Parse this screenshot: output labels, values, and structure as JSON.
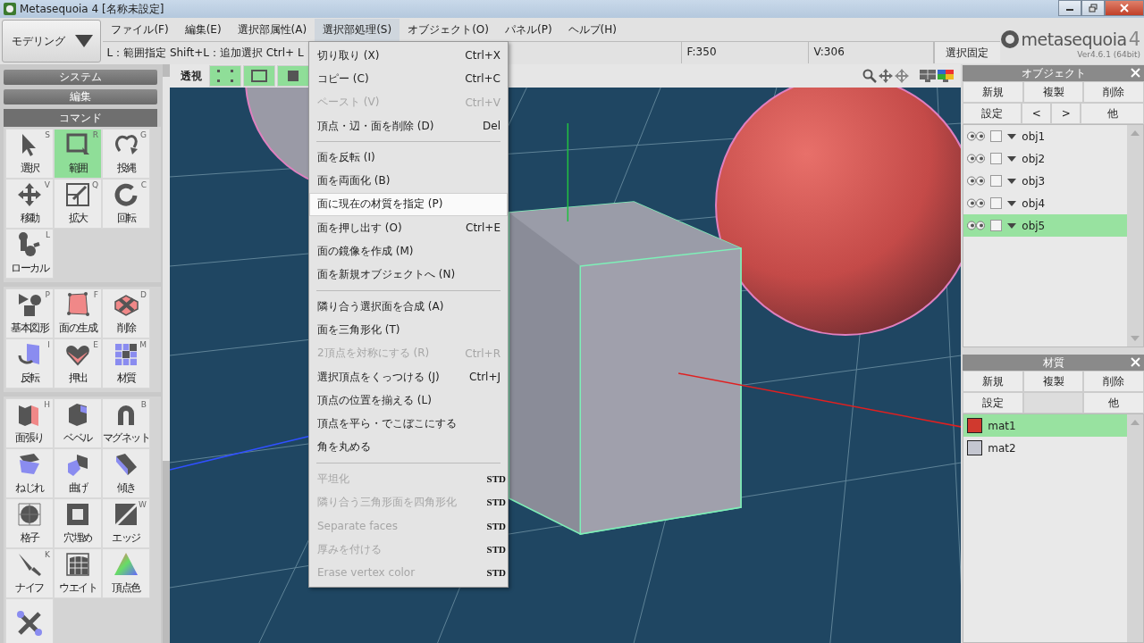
{
  "window": {
    "title": "Metasequoia 4 [名称未設定]"
  },
  "mode_dropdown": {
    "value": "モデリング"
  },
  "menu_bar": [
    {
      "label": "ファイル(F)",
      "selected": false
    },
    {
      "label": "編集(E)",
      "selected": false
    },
    {
      "label": "選択部属性(A)",
      "selected": false
    },
    {
      "label": "選択部処理(S)",
      "selected": true
    },
    {
      "label": "オブジェクト(O)",
      "selected": false
    },
    {
      "label": "パネル(P)",
      "selected": false
    },
    {
      "label": "ヘルプ(H)",
      "selected": false
    }
  ],
  "status_bar": {
    "hint": "L：範囲指定 Shift+L：追加選択 Ctrl+ L",
    "faces": "F:350",
    "vertices": "V:306",
    "lock_button": "選択固定"
  },
  "logo": {
    "text": "metasequoia",
    "number": "4",
    "version": "Ver4.6.1 (64bit)"
  },
  "left_panel": {
    "system_button": "システム",
    "edit_button": "編集",
    "command_header": "コマンド",
    "tool_groups": [
      [
        {
          "label": "選択",
          "key": "S",
          "selected": false
        },
        {
          "label": "範囲",
          "key": "R",
          "selected": true
        },
        {
          "label": "投縄",
          "key": "G",
          "selected": false
        },
        {
          "label": "移動",
          "key": "V",
          "selected": false
        },
        {
          "label": "拡大",
          "key": "Q",
          "selected": false
        },
        {
          "label": "回転",
          "key": "C",
          "selected": false
        },
        {
          "label": "ローカル",
          "key": "L",
          "selected": false
        }
      ],
      [
        {
          "label": "基本図形",
          "key": "P",
          "selected": false
        },
        {
          "label": "面の生成",
          "key": "F",
          "selected": false
        },
        {
          "label": "削除",
          "key": "D",
          "selected": false
        },
        {
          "label": "反転",
          "key": "I",
          "selected": false
        },
        {
          "label": "押出",
          "key": "E",
          "selected": false
        },
        {
          "label": "材質",
          "key": "M",
          "selected": false
        }
      ],
      [
        {
          "label": "面張り",
          "key": "H",
          "selected": false
        },
        {
          "label": "ベベル",
          "selected": false
        },
        {
          "label": "マグネット",
          "key": "B",
          "selected": false
        },
        {
          "label": "ねじれ",
          "selected": false
        },
        {
          "label": "曲げ",
          "selected": false
        },
        {
          "label": "傾き",
          "selected": false
        },
        {
          "label": "格子",
          "selected": false
        },
        {
          "label": "穴埋め",
          "selected": false
        },
        {
          "label": "エッジ",
          "key": "W",
          "selected": false
        },
        {
          "label": "ナイフ",
          "key": "K",
          "selected": false
        },
        {
          "label": "ウエイト",
          "selected": false
        },
        {
          "label": "頂点色",
          "selected": false
        },
        {
          "selected": false
        }
      ]
    ]
  },
  "viewport": {
    "view_tab": "透視",
    "select_modes": [
      {
        "on": true
      },
      {
        "on": true
      },
      {
        "on": true
      }
    ]
  },
  "menu": [
    {
      "kind": "item",
      "label": "切り取り (X)",
      "shortcut": "Ctrl+X",
      "disabled": false,
      "selected": false
    },
    {
      "kind": "item",
      "label": "コピー (C)",
      "shortcut": "Ctrl+C",
      "disabled": false,
      "selected": false
    },
    {
      "kind": "item",
      "label": "ペースト (V)",
      "shortcut": "Ctrl+V",
      "disabled": true,
      "selected": false
    },
    {
      "kind": "item",
      "label": "頂点・辺・面を削除 (D)",
      "shortcut": "Del",
      "disabled": false,
      "selected": false
    },
    {
      "kind": "separator"
    },
    {
      "kind": "item",
      "label": "面を反転 (I)",
      "disabled": false,
      "selected": false
    },
    {
      "kind": "item",
      "label": "面を両面化 (B)",
      "disabled": false,
      "selected": false
    },
    {
      "kind": "item",
      "label": "面に現在の材質を指定 (P)",
      "disabled": false,
      "selected": true
    },
    {
      "kind": "item",
      "label": "面を押し出す (O)",
      "shortcut": "Ctrl+E",
      "disabled": false,
      "selected": false
    },
    {
      "kind": "item",
      "label": "面の鏡像を作成 (M)",
      "disabled": false,
      "selected": false
    },
    {
      "kind": "item",
      "label": "面を新規オブジェクトへ (N)",
      "disabled": false,
      "selected": false
    },
    {
      "kind": "separator"
    },
    {
      "kind": "item",
      "label": "隣り合う選択面を合成 (A)",
      "disabled": false,
      "selected": false
    },
    {
      "kind": "item",
      "label": "面を三角形化 (T)",
      "disabled": false,
      "selected": false
    },
    {
      "kind": "item",
      "label": "2頂点を対称にする (R)",
      "shortcut": "Ctrl+R",
      "disabled": true,
      "selected": false
    },
    {
      "kind": "item",
      "label": "選択頂点をくっつける (J)",
      "shortcut": "Ctrl+J",
      "disabled": false,
      "selected": false
    },
    {
      "kind": "item",
      "label": "頂点の位置を揃える (L)",
      "disabled": false,
      "selected": false
    },
    {
      "kind": "item",
      "label": "頂点を平ら・でこぼこにする",
      "disabled": false,
      "selected": false
    },
    {
      "kind": "item",
      "label": "角を丸める",
      "disabled": false,
      "selected": false
    },
    {
      "kind": "separator"
    },
    {
      "kind": "item",
      "label": "平坦化",
      "badge": "STD",
      "disabled": true,
      "selected": false
    },
    {
      "kind": "item",
      "label": "隣り合う三角形面を四角形化",
      "badge": "STD",
      "disabled": true,
      "selected": false
    },
    {
      "kind": "item",
      "label": "Separate faces",
      "badge": "STD",
      "disabled": true,
      "selected": false
    },
    {
      "kind": "item",
      "label": "厚みを付ける",
      "badge": "STD",
      "disabled": true,
      "selected": false
    },
    {
      "kind": "item",
      "label": "Erase vertex color",
      "badge": "STD",
      "disabled": true,
      "selected": false
    }
  ],
  "object_panel": {
    "title": "オブジェクト",
    "buttons": [
      "新規",
      "複製",
      "削除"
    ],
    "buttons_2": [
      "設定",
      "<",
      ">",
      "他"
    ],
    "items": [
      {
        "name": "obj1",
        "selected": false
      },
      {
        "name": "obj2",
        "selected": false
      },
      {
        "name": "obj3",
        "selected": false
      },
      {
        "name": "obj4",
        "selected": false
      },
      {
        "name": "obj5",
        "selected": true
      }
    ]
  },
  "material_panel": {
    "title": "材質",
    "buttons": [
      "新規",
      "複製",
      "削除"
    ],
    "buttons_2": [
      "設定",
      "他"
    ],
    "items": [
      {
        "name": "mat1",
        "color": "#d0392e",
        "selected": true
      },
      {
        "name": "mat2",
        "color": "#c4c6d0",
        "selected": false
      }
    ]
  }
}
